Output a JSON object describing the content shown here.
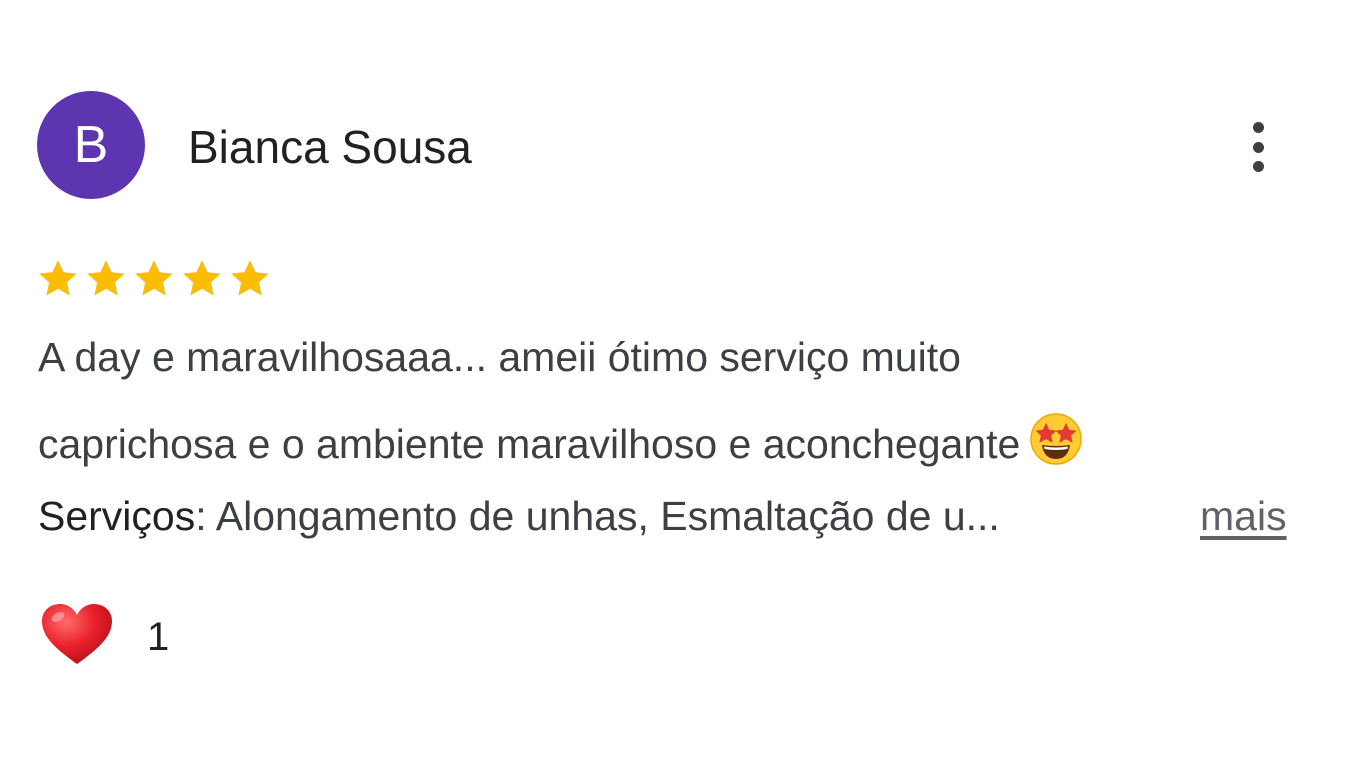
{
  "review": {
    "avatar_letter": "B",
    "author": "Bianca Sousa",
    "menu_icon": "more-vert-icon",
    "rating": 5,
    "rating_max": 5,
    "star_color": "#fbbc04",
    "avatar_color": "#5e35b1",
    "text_line1": "A day e maravilhosaaa... ameii ótimo serviço muito",
    "text_line2": "caprichosa e o ambiente maravilhoso e aconchegante",
    "text_emoji": "star-struck-emoji",
    "services_label": "Serviços",
    "services_value": ": Alongamento de unhas, Esmaltação de u...",
    "more_label": "mais",
    "reaction_icon": "red-heart-icon",
    "reaction_count": "1"
  }
}
